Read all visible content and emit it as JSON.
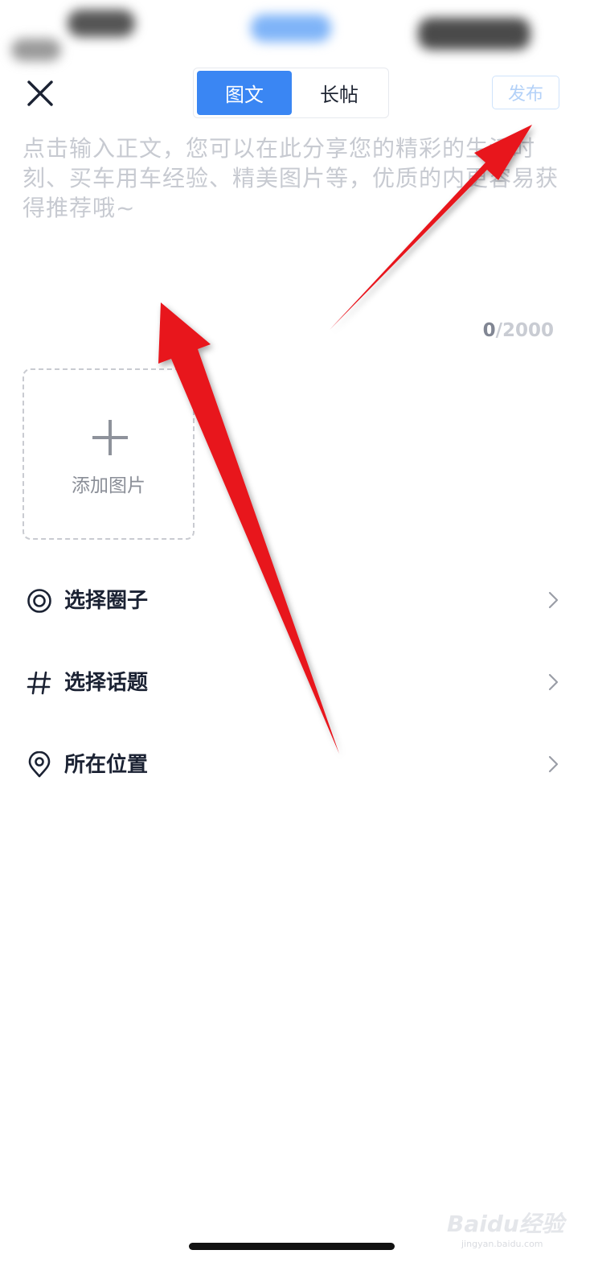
{
  "header": {
    "close_icon": "close-icon",
    "tabs": [
      {
        "label": "图文",
        "active": true
      },
      {
        "label": "长帖",
        "active": false
      }
    ],
    "publish_label": "发布"
  },
  "editor": {
    "placeholder": "点击输入正文，您可以在此分享您的精彩的生活时刻、买车用车经验、精美图片等，优质的内更容易获得推荐哦~",
    "count_current": "0",
    "count_max": "/2000"
  },
  "media": {
    "add_photo_label": "添加图片",
    "icon": "plus-icon"
  },
  "options": [
    {
      "label": "选择圈子",
      "icon": "circle-target-icon"
    },
    {
      "label": "选择话题",
      "icon": "hashtag-icon"
    },
    {
      "label": "所在位置",
      "icon": "location-pin-icon"
    }
  ],
  "watermark": {
    "text": "Baidu经验",
    "sub": "jingyan.baidu.com"
  },
  "colors": {
    "accent": "#3a86f3",
    "arrow": "#e8121b"
  }
}
